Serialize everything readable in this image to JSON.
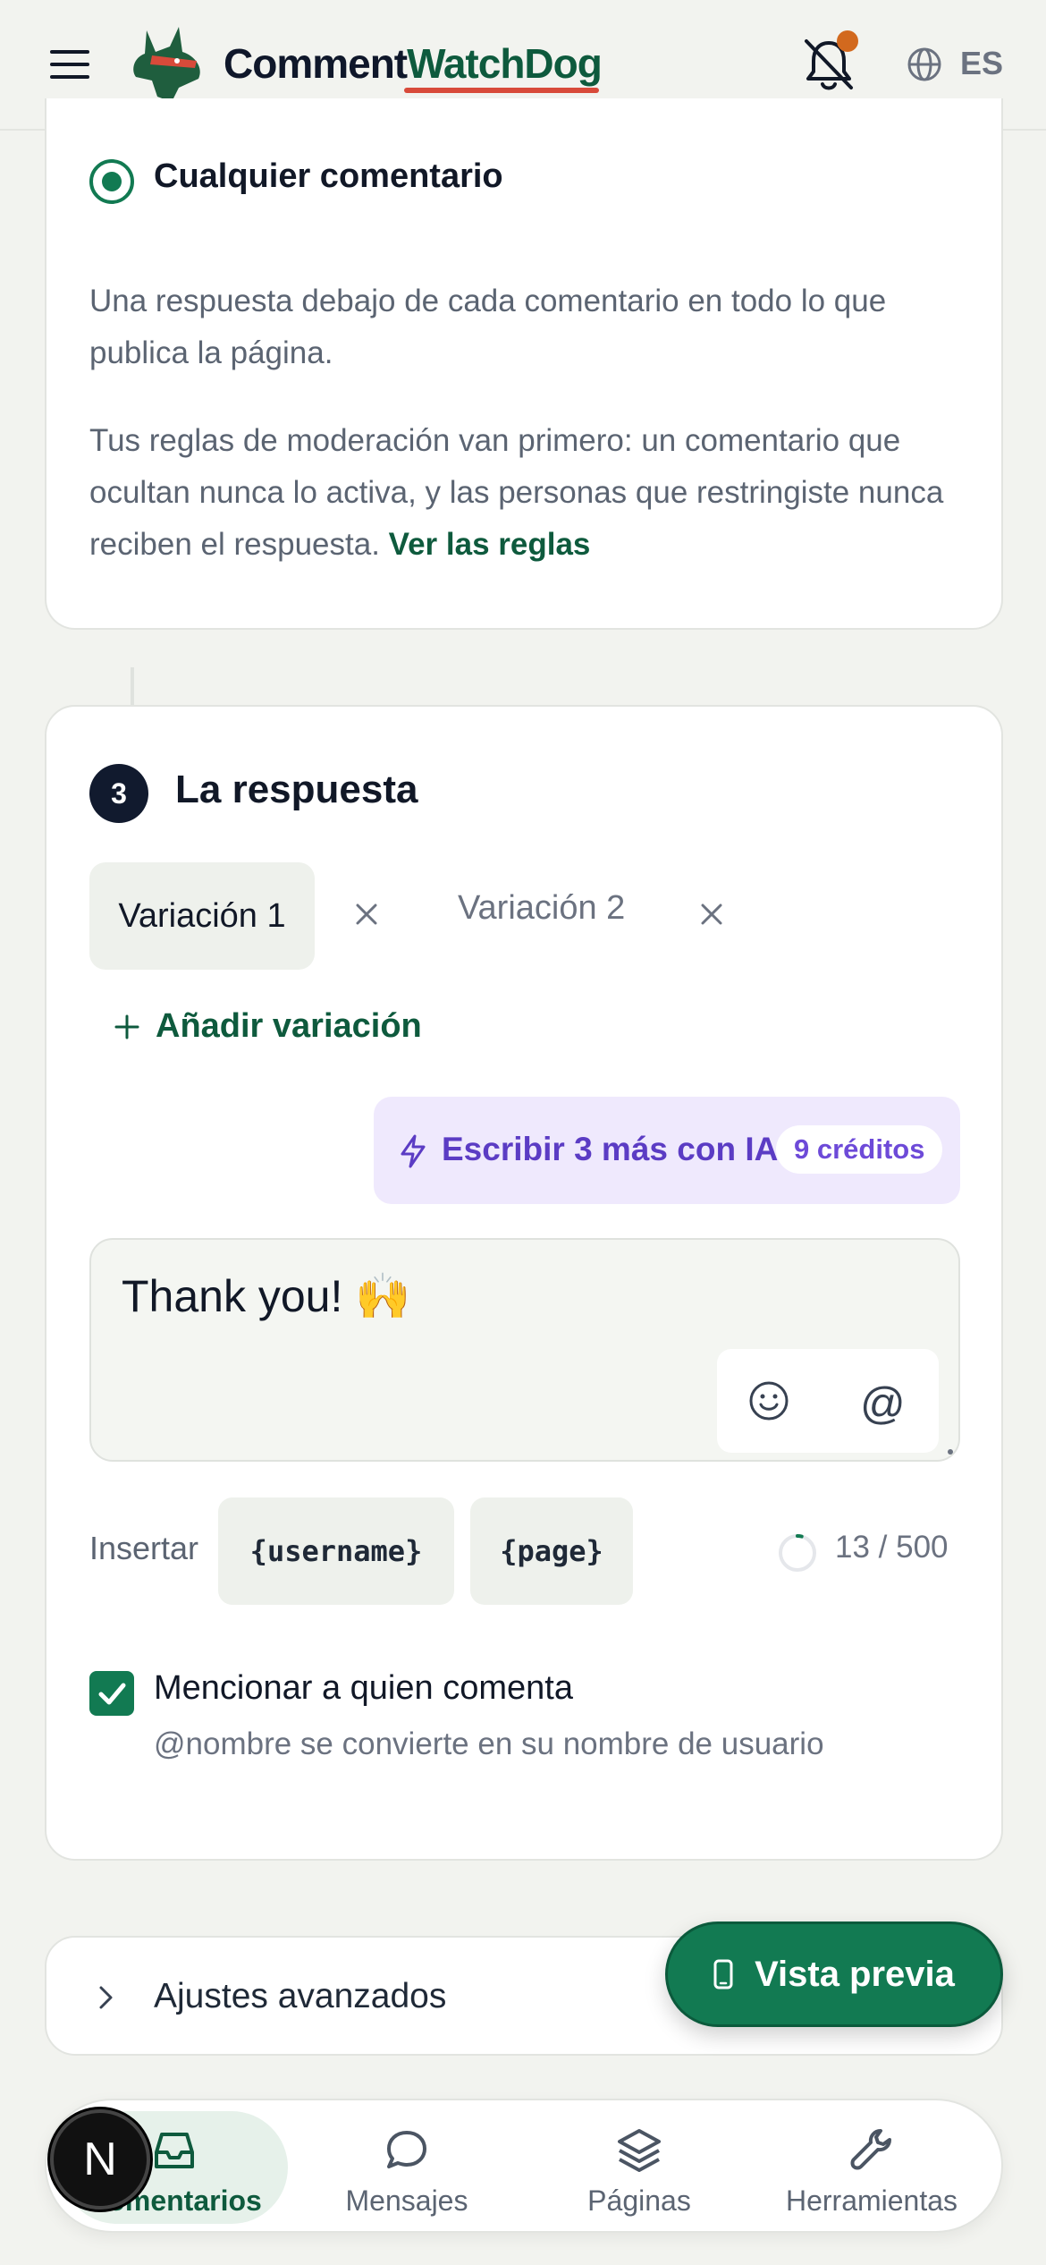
{
  "header": {
    "brand_part1": "Comment",
    "brand_part2": "WatchDog",
    "language": "ES",
    "icons": [
      "menu-icon",
      "logo-dog-icon",
      "bell-off-icon",
      "globe-icon"
    ],
    "accent_color": "#0e5a3d",
    "underline_color": "#d84a3a"
  },
  "trigger": {
    "selected_option": "Cualquier comentario",
    "description": "Una respuesta debajo de cada comentario en todo lo que publica la página.",
    "rules_text": "Tus reglas de moderación van primero: un comentario que ocultan nunca lo activa, y las personas que restringiste nunca reciben el respuesta.",
    "rules_link": "Ver las reglas"
  },
  "response": {
    "step_number": "3",
    "title": "La respuesta",
    "tabs": [
      {
        "label": "Variación 1",
        "active": true
      },
      {
        "label": "Variación 2",
        "active": false
      }
    ],
    "add_variation": "Añadir variación",
    "ai_button": "Escribir 3 más con IA",
    "ai_credits": "9 créditos",
    "message_text": "Thank you! 🙌",
    "at_symbol": "@",
    "insert_label": "Insertar",
    "variables": [
      "{username}",
      "{page}"
    ],
    "char_count": "13 / 500",
    "char_progress": 0.026,
    "mention_label": "Mencionar a quien comenta",
    "mention_checked": true,
    "mention_hint": "@nombre se convierte en su nombre de usuario"
  },
  "advanced": {
    "label": "Ajustes avanzados"
  },
  "preview_button": "Vista previa",
  "bottom_nav": {
    "items": [
      {
        "label": "Comentarios",
        "icon": "inbox-icon",
        "active": true
      },
      {
        "label": "Mensajes",
        "icon": "chat-bubble-icon",
        "active": false
      },
      {
        "label": "Páginas",
        "icon": "layers-icon",
        "active": false
      },
      {
        "label": "Herramientas",
        "icon": "wrench-icon",
        "active": false
      }
    ]
  },
  "dev_badge": "N",
  "primary_color": "#127a52",
  "ai_color": "#5b3cc4"
}
